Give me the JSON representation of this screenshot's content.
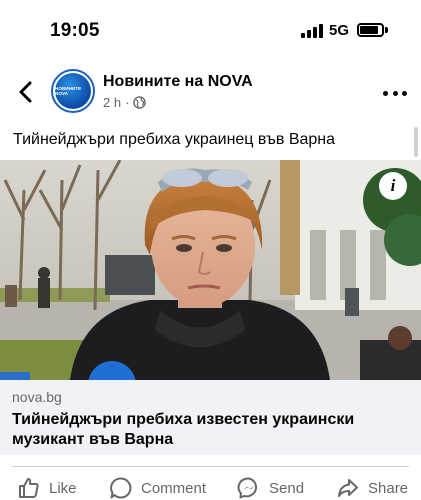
{
  "status_bar": {
    "time": "19:05",
    "network": "5G"
  },
  "post": {
    "page_name": "Новините на NOVA",
    "avatar_text": "НОВИНИТЕ NOVA",
    "time_ago": "2 h",
    "separator": "·",
    "caption": "Тийнейджъри пребиха украинец във Варна"
  },
  "link": {
    "domain": "nova.bg",
    "title": "Тийнейджъри пребиха известен украински музикант във Варна"
  },
  "actions": {
    "like": "Like",
    "comment": "Comment",
    "send": "Send",
    "share": "Share"
  },
  "icons": {
    "back": "chevron-left-icon",
    "globe": "globe-icon",
    "more": "more-horizontal-icon",
    "info": "info-icon",
    "like": "thumbs-up-icon",
    "comment": "comment-bubble-icon",
    "send": "messenger-icon",
    "share": "share-arrow-icon"
  },
  "colors": {
    "brand_blue": "#1e5fbf",
    "secondary_text": "#65676b",
    "link_bg": "#f0f2f5"
  }
}
